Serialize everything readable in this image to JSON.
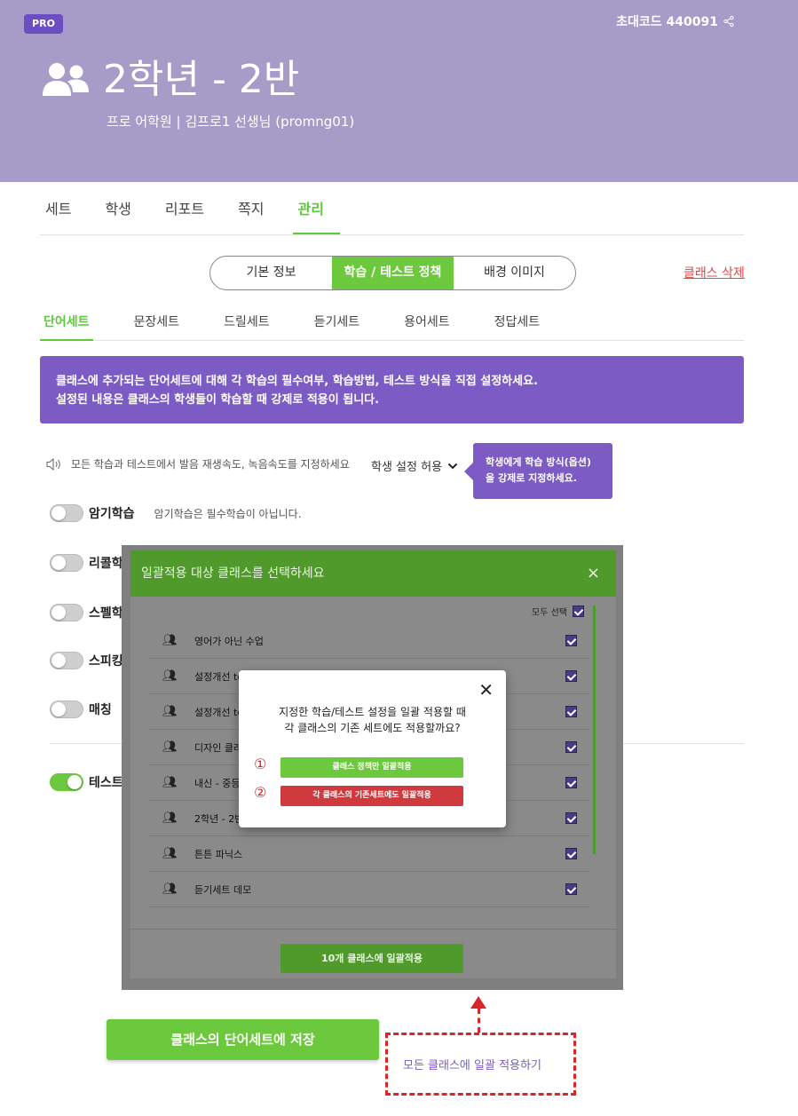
{
  "header": {
    "badge": "PRO",
    "invite_code": "초대코드 440091",
    "class_title": "2학년 - 2반",
    "class_sub": "프로 어학원 | 김프로1 선생님 (promng01)"
  },
  "tabs": [
    "세트",
    "학생",
    "리포트",
    "쪽지",
    "관리"
  ],
  "segments": [
    "기본 정보",
    "학습 / 테스트 정책",
    "배경 이미지"
  ],
  "delete_link": "클래스 삭제",
  "subtabs": [
    "단어세트",
    "문장세트",
    "드릴세트",
    "듣기세트",
    "용어세트",
    "정답세트"
  ],
  "notice": {
    "line1": "클래스에 추가되는 단어세트에 대해 각 학습의 필수여부, 학습방법, 테스트 방식을 직접 설정하세요.",
    "line2": "설정된 내용은 클래스의 학생들이 학습할 때 강제로 적용이 됩니다."
  },
  "speed": {
    "text": "모든 학습과 테스트에서 발음 재생속도, 녹음속도를 지정하세요",
    "allow": "학생 설정 허용"
  },
  "tooltip": {
    "line1": "학생에게 학습 방식(옵션)",
    "line2": "을 강제로 지정하세요."
  },
  "toggles": [
    {
      "label": "암기학습",
      "desc": "암기학습은 필수학습이 아닙니다.",
      "on": false
    },
    {
      "label": "리콜학",
      "desc": "",
      "on": false
    },
    {
      "label": "스펠학",
      "desc": "",
      "on": false
    },
    {
      "label": "스피킹",
      "desc": "",
      "on": false
    },
    {
      "label": "매칭",
      "desc": "",
      "on": false
    },
    {
      "label": "테스트",
      "desc": "",
      "on": true
    }
  ],
  "modal": {
    "title": "일괄적용 대상 클래스를 선택하세요",
    "select_all": "모두 선택",
    "rows": [
      "영어가 아닌 수업",
      "설정개선 te",
      "설정개선 te",
      "디자인 클래",
      "내신 - 중등",
      "2학년 - 2반",
      "튼튼 파닉스",
      "듣기세트 데모"
    ],
    "apply_button": "10개 클래스에 일괄적용"
  },
  "confirm": {
    "q1": "지정한 학습/테스트 설정을 일괄 적용할 때",
    "q2": "각 클래스의 기존 세트에도 적용할까요?",
    "num1": "①",
    "num2": "②",
    "btn_policy_only": "클래스 정책만 일괄적용",
    "btn_existing_sets": "각 클래스의 기존세트에도 일괄적용"
  },
  "bottom": {
    "save_button": "클래스의 단어세트에 저장",
    "apply_all_link": "모든 클래스에 일괄 적용하기"
  },
  "colors": {
    "header_bg": "#a79bc8",
    "accent_green": "#6cc83c",
    "accent_purple": "#7c5cc4",
    "danger_red": "#d8262b"
  }
}
